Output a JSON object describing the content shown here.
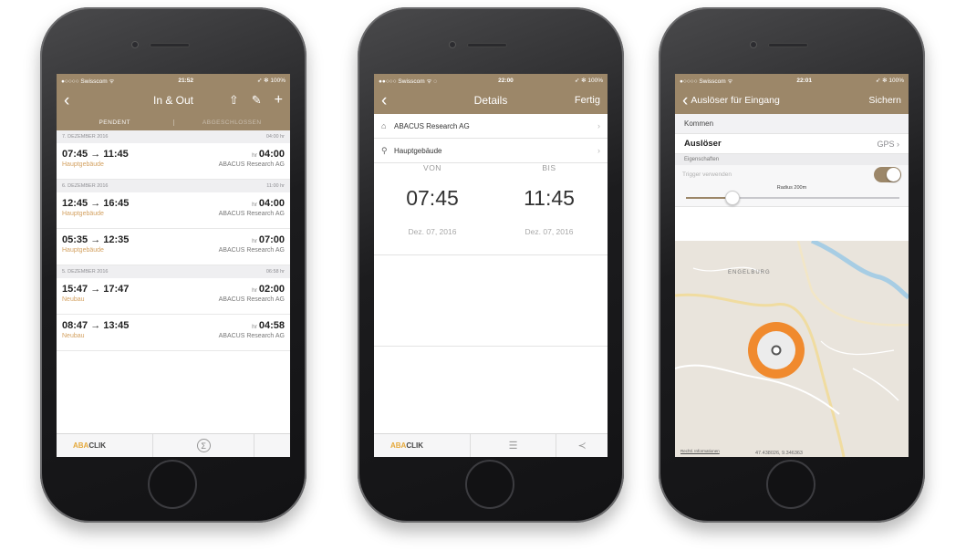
{
  "colors": {
    "brand_brown": "#9c8769",
    "accent_orange": "#e5a93c",
    "place_orange": "#d4a262",
    "map_circle": "#f08a2e"
  },
  "icons": [
    "chevron-left-icon",
    "share-icon",
    "pencil-icon",
    "plus-icon",
    "sigma-icon",
    "list-icon",
    "network-share-icon",
    "building-icon",
    "location-pin-icon",
    "chevron-right-icon",
    "location-dot-icon"
  ],
  "phone1": {
    "status": {
      "carrier": "●○○○○ Swisscom ᯤ",
      "time": "21:52",
      "battery": "➶ ✻ 100%"
    },
    "nav": {
      "back": "‹",
      "title": "In & Out",
      "share": "⇧",
      "edit": "✎",
      "add": "+"
    },
    "segments": {
      "active": "PENDENT",
      "inactive": "ABGESCHLOSSEN"
    },
    "days": [
      {
        "date": "7. DEZEMBER 2016",
        "total": "04:00 hr",
        "entries": [
          {
            "time": "07:45 → 11:45",
            "place": "Hauptgebäude",
            "hr": "hr",
            "duration": "04:00",
            "company": "ABACUS Research AG"
          }
        ]
      },
      {
        "date": "6. DEZEMBER 2016",
        "total": "11:00 hr",
        "entries": [
          {
            "time": "12:45 → 16:45",
            "place": "Hauptgebäude",
            "hr": "hr",
            "duration": "04:00",
            "company": "ABACUS Research AG"
          },
          {
            "time": "05:35 → 12:35",
            "place": "Hauptgebäude",
            "hr": "hr",
            "duration": "07:00",
            "company": "ABACUS Research AG"
          }
        ]
      },
      {
        "date": "5. DEZEMBER 2016",
        "total": "06:58 hr",
        "entries": [
          {
            "time": "15:47 → 17:47",
            "place": "Neubau",
            "hr": "hr",
            "duration": "02:00",
            "company": "ABACUS Research AG"
          },
          {
            "time": "08:47 → 13:45",
            "place": "Neubau",
            "hr": "hr",
            "duration": "04:58",
            "company": "ABACUS Research AG"
          }
        ]
      }
    ],
    "tabbar": {
      "logo_aba": "ABA",
      "logo_clik": "CLIK",
      "sigma": "Σ"
    }
  },
  "phone2": {
    "status": {
      "carrier": "●●○○○ Swisscom ᯤ ◌",
      "time": "22:00",
      "battery": "➶ ✻ 100%"
    },
    "nav": {
      "back": "‹",
      "title": "Details",
      "done": "Fertig"
    },
    "company_row": {
      "icon": "⌂",
      "label": "ABACUS Research AG",
      "chevron": "›"
    },
    "place_row": {
      "icon": "⚲",
      "label": "Hauptgebäude",
      "chevron": "›"
    },
    "von": {
      "label": "VON",
      "time": "07:45",
      "date": "Dez. 07, 2016"
    },
    "bis": {
      "label": "BIS",
      "time": "11:45",
      "date": "Dez. 07, 2016"
    },
    "tabbar": {
      "logo_aba": "ABA",
      "logo_clik": "CLIK",
      "list": "☰",
      "share": "≺"
    }
  },
  "phone3": {
    "status": {
      "carrier": "●○○○○ Swisscom ᯤ",
      "time": "22:01",
      "battery": "➶ ✻ 100%"
    },
    "nav": {
      "back": "‹",
      "back_label": "Auslöser für Eingang",
      "save": "Sichern"
    },
    "kommen": "Kommen",
    "ausloeser": {
      "label": "Auslöser",
      "value": "GPS",
      "chevron": "›"
    },
    "section": "Eigenschaften",
    "trigger_label": "Trigger verwenden",
    "trigger_on": true,
    "radius_label": "Radius 200m",
    "radius_fraction": 0.22,
    "map": {
      "place": "ENGELBURG",
      "legal": "Rechtl. Informationen",
      "coords": "47.438026, 9.346363"
    }
  }
}
